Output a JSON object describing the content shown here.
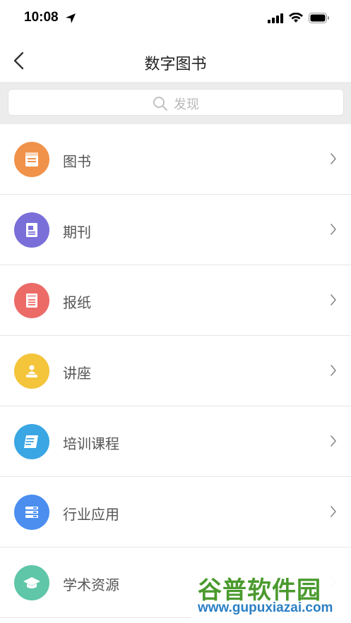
{
  "status_bar": {
    "time": "10:08"
  },
  "nav": {
    "title": "数字图书"
  },
  "search": {
    "placeholder": "发现"
  },
  "items": [
    {
      "label": "图书",
      "icon": "book-icon",
      "color": "#f0924a"
    },
    {
      "label": "期刊",
      "icon": "journal-icon",
      "color": "#7a6fd8"
    },
    {
      "label": "报纸",
      "icon": "newspaper-icon",
      "color": "#ec6b67"
    },
    {
      "label": "讲座",
      "icon": "lecture-icon",
      "color": "#f4c43a"
    },
    {
      "label": "培训课程",
      "icon": "training-course-icon",
      "color": "#3aa6e4"
    },
    {
      "label": "行业应用",
      "icon": "industry-app-icon",
      "color": "#4b8ef0"
    },
    {
      "label": "学术资源",
      "icon": "academic-cap-icon",
      "color": "#5fc6a8"
    }
  ],
  "watermark": {
    "title": "谷普软件园",
    "url": "www.gupuxiazai.com"
  }
}
